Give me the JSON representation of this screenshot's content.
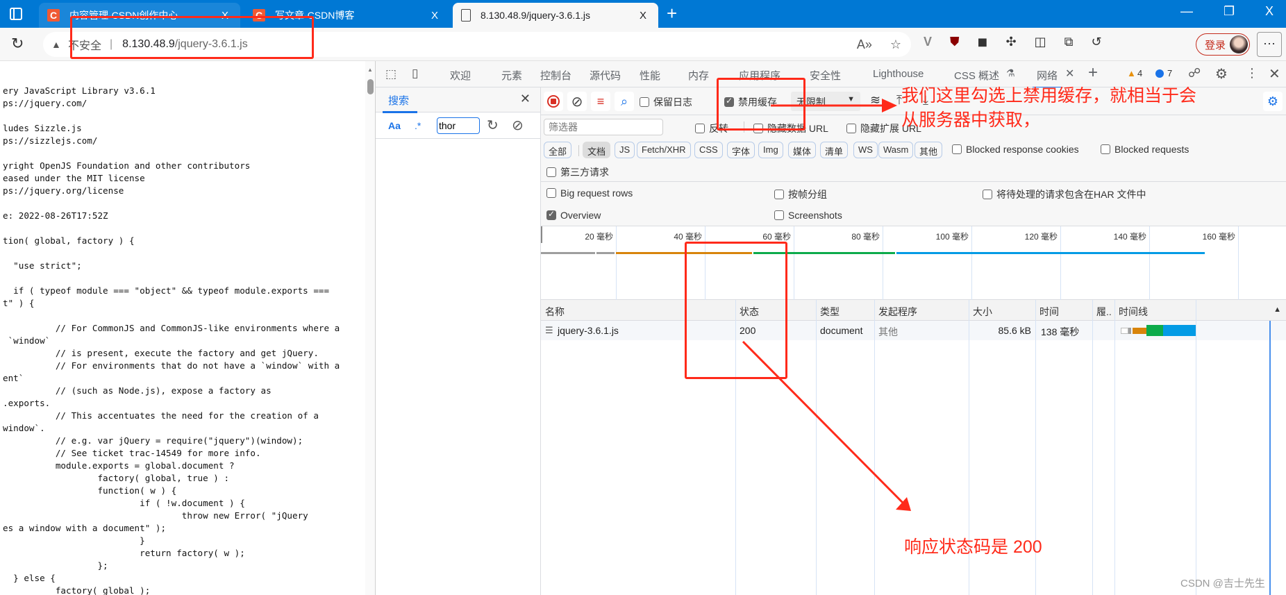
{
  "browser": {
    "tabs": [
      {
        "label": "内容管理-CSDN创作中心",
        "icon": "csdn-c-icon",
        "active": false
      },
      {
        "label": "写文章-CSDN博客",
        "icon": "csdn-c-icon",
        "active": false
      },
      {
        "label": "8.130.48.9/jquery-3.6.1.js",
        "icon": "document-icon",
        "active": true
      }
    ],
    "close_glyph": "X",
    "new_tab_glyph": "+",
    "window_controls": {
      "minimize": "—",
      "restore": "❐",
      "close": "X"
    },
    "address": {
      "security_label": "不安全",
      "separator": "|",
      "host": "8.130.48.9",
      "path": "/jquery-3.6.1.js"
    },
    "login_label": "登录",
    "more_glyph": "···"
  },
  "code_lines": [
    "ery JavaScript Library v3.6.1",
    "ps://jquery.com/",
    "",
    "ludes Sizzle.js",
    "ps://sizzlejs.com/",
    "",
    "yright OpenJS Foundation and other contributors",
    "eased under the MIT license",
    "ps://jquery.org/license",
    "",
    "e: 2022-08-26T17:52Z",
    "",
    "tion( global, factory ) {",
    "",
    "  \"use strict\";",
    "",
    "  if ( typeof module === \"object\" && typeof module.exports ===",
    "t\" ) {",
    "",
    "          // For CommonJS and CommonJS-like environments where a",
    " `window`",
    "          // is present, execute the factory and get jQuery.",
    "          // For environments that do not have a `window` with a",
    "ent`",
    "          // (such as Node.js), expose a factory as",
    ".exports.",
    "          // This accentuates the need for the creation of a",
    "window`.",
    "          // e.g. var jQuery = require(\"jquery\")(window);",
    "          // See ticket trac-14549 for more info.",
    "          module.exports = global.document ?",
    "                  factory( global, true ) :",
    "                  function( w ) {",
    "                          if ( !w.document ) {",
    "                                  throw new Error( \"jQuery",
    "es a window with a document\" );",
    "                          }",
    "                          return factory( w );",
    "                  };",
    "  } else {",
    "          factory( global );"
  ],
  "devtools": {
    "tabs": [
      "欢迎",
      "元素",
      "控制台",
      "源代码",
      "性能",
      "内存",
      "应用程序",
      "安全性",
      "Lighthouse",
      "CSS 概述",
      "网络"
    ],
    "active_tab": "网络",
    "warnings_count": "4",
    "messages_count": "7",
    "search": {
      "tab_label": "搜索",
      "case_label": "Aa",
      "regex_label": ".*",
      "query": "thor"
    },
    "network": {
      "preserve_log_label": "保留日志",
      "preserve_log_checked": false,
      "disable_cache_label": "禁用缓存",
      "disable_cache_checked": true,
      "throttling": "无限制",
      "filter_placeholder": "筛选器",
      "invert_label": "反转",
      "hide_data_urls_label": "隐藏数据 URL",
      "hide_ext_urls_label": "隐藏扩展 URL",
      "type_filters": [
        "全部",
        "文档",
        "JS",
        "Fetch/XHR",
        "CSS",
        "字体",
        "Img",
        "媒体",
        "清单",
        "WS",
        "Wasm",
        "其他"
      ],
      "selected_type": "文档",
      "blocked_cookies_label": "Blocked response cookies",
      "blocked_requests_label": "Blocked requests",
      "third_party_label": "第三方请求",
      "settings": {
        "big_rows": {
          "label": "Big request rows",
          "checked": false
        },
        "group_by_frame": {
          "label": "按帧分组",
          "checked": false
        },
        "har_pending": {
          "label": "将待处理的请求包含在HAR 文件中",
          "checked": false
        },
        "overview": {
          "label": "Overview",
          "checked": true
        },
        "screenshots": {
          "label": "Screenshots",
          "checked": false
        }
      },
      "overview_ticks": [
        "20 毫秒",
        "40 毫秒",
        "60 毫秒",
        "80 毫秒",
        "100 毫秒",
        "120 毫秒",
        "140 毫秒",
        "160 毫秒"
      ],
      "columns": [
        "名称",
        "状态",
        "类型",
        "发起程序",
        "大小",
        "时间",
        "履..",
        "时间线"
      ],
      "rows": [
        {
          "name": "jquery-3.6.1.js",
          "status": "200",
          "type": "document",
          "initiator": "其他",
          "size": "85.6 kB",
          "time": "138 毫秒"
        }
      ],
      "colors": {
        "queue": "#9e9e9e",
        "waiting": "#d8840b",
        "ttfb": "#0cab4b",
        "download": "#039be5"
      }
    }
  },
  "annotations": {
    "note_disable_cache_line1": "我们这里勾选上禁用缓存，就相当于会",
    "note_disable_cache_line2": "从服务器中获取，",
    "note_status": "响应状态码是 200",
    "color": "#ff2a1a"
  },
  "watermark": "CSDN @吉士先生"
}
